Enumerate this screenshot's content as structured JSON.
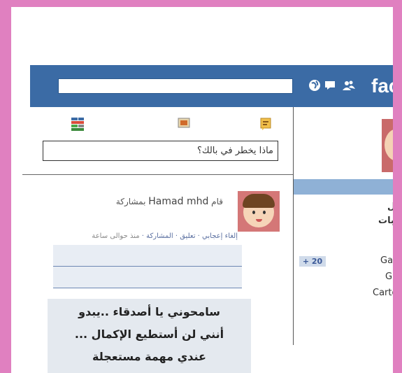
{
  "brand": "fac",
  "status_placeholder": "ماذا يخطر في بالك؟",
  "post": {
    "prefix": "قام",
    "user": "Hamad mhd",
    "suffix": "بمشاركة",
    "actions": [
      "إلغاء إعجابي",
      "تعليق",
      "المشاركة"
    ],
    "time": "منذ حوالى ساعة"
  },
  "overlay_lines": [
    "سامحوني يا أصدقاء ..يبدو",
    "أنني لن أستطيع الإكمال ...",
    "عندي مهمة مستعجلة"
  ],
  "right_column": {
    "label1": "ل",
    "label2": "بات",
    "badge": "+ 20",
    "items": [
      "Ga",
      "G",
      "Carto"
    ]
  },
  "icons": [
    "globe-icon",
    "messages-icon",
    "friends-icon",
    "status-icon",
    "photo-icon",
    "list-icon"
  ],
  "colors": {
    "topbar": "#3b6ba5",
    "background": "#e080c0"
  }
}
